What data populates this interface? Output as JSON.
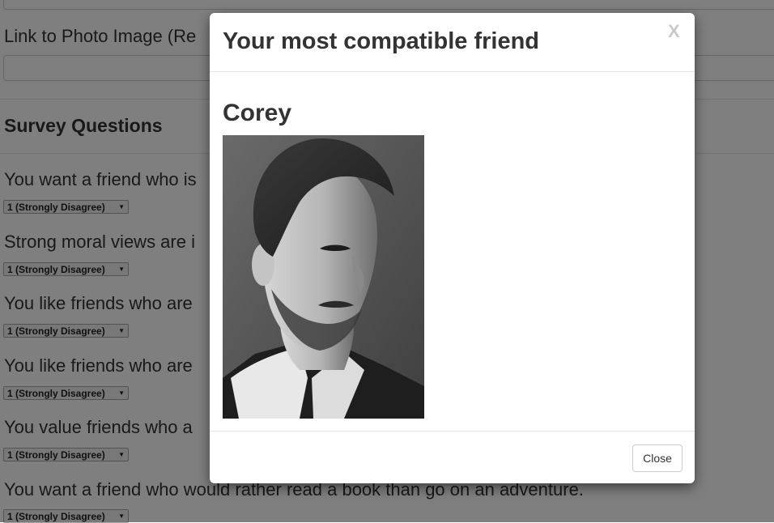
{
  "form": {
    "photo_label": "Link to Photo Image (Re",
    "survey_title": "Survey Questions"
  },
  "questions": [
    {
      "text": "You want a friend who is",
      "answer": "1 (Strongly Disagree)"
    },
    {
      "text": "Strong moral views are i",
      "answer": "1 (Strongly Disagree)"
    },
    {
      "text": "You like friends who are",
      "answer": "1 (Strongly Disagree)"
    },
    {
      "text": "You like friends who are",
      "answer": "1 (Strongly Disagree)"
    },
    {
      "text": "You value friends who a",
      "answer": "1 (Strongly Disagree)"
    },
    {
      "text": "You want a friend who would rather read a book than go on an adventure.",
      "answer": "1 (Strongly Disagree)"
    }
  ],
  "select_arrow": "▼",
  "modal": {
    "title": "Your most compatible friend",
    "close_x": "X",
    "friend_name": "Corey",
    "close_label": "Close"
  },
  "colors": {
    "backdrop": "rgba(0,0,0,0.5)",
    "text": "#333333",
    "divider": "#e5e5e5",
    "close_x": "#c9c9c9"
  }
}
